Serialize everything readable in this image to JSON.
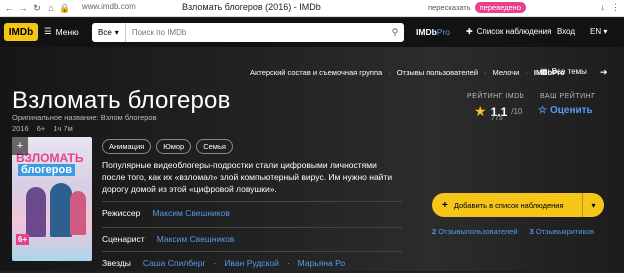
{
  "browser": {
    "url": "www.imdb.com",
    "tab_title": "Взломать блогеров (2016) - IMDb",
    "translate_label": "пересказать",
    "translated_badge": "переведено"
  },
  "topbar": {
    "logo": "IMDb",
    "menu_label": "Меню",
    "search_category": "Все",
    "search_placeholder": "Поиск по IMDb",
    "pro_prefix": "IMDb",
    "pro_suffix": "Pro",
    "watchlist_label": "Список наблюдения",
    "signin_label": "Вход",
    "language": "EN"
  },
  "subnav": {
    "items": [
      "Актерский состав и съемочная группа",
      "Отзывы пользователей",
      "Мелочи",
      "IMDbPro"
    ],
    "themes_label": "Все темы"
  },
  "movie": {
    "title": "Взломать блогеров",
    "original_title": "Оригинальное название: Взлом блогеров",
    "year": "2016",
    "age": "6+",
    "runtime": "1ч 7м",
    "genres": [
      "Анимация",
      "Юмор",
      "Семья"
    ],
    "plot": "Популярные видеоблогеры-подростки стали цифровыми личностями после того, как их «взломал» злой компьютерный вирус. Им нужно найти дорогу домой из этой «цифровой ловушки».",
    "director_label": "Режиссер",
    "director": "Максим Свешников",
    "writer_label": "Сценарист",
    "writer": "Максим Свешников",
    "stars_label": "Звезды",
    "stars": [
      "Саша Спилберг",
      "Иван Рудской",
      "Марьяна Ро"
    ]
  },
  "poster": {
    "line1": "ВЗЛОМАТЬ",
    "line2": "блогеров",
    "age_badge": "6+"
  },
  "rating": {
    "imdb_label": "РЕЙТИНГ IMDb",
    "value": "1.1",
    "max": "/10",
    "count": "775",
    "your_label": "ВАШ РЕЙТИНГ",
    "rate_label": "Оценить"
  },
  "actions": {
    "add_watchlist": "Добавить в список наблюдения",
    "user_reviews_count": "2",
    "user_reviews_label": "Отзывыпользователей",
    "critic_reviews_count": "3",
    "critic_reviews_label": "Отзывыкритиков"
  },
  "colors": {
    "accent": "#f5c518",
    "link": "#5799ef",
    "background": "#1f1f1f"
  }
}
